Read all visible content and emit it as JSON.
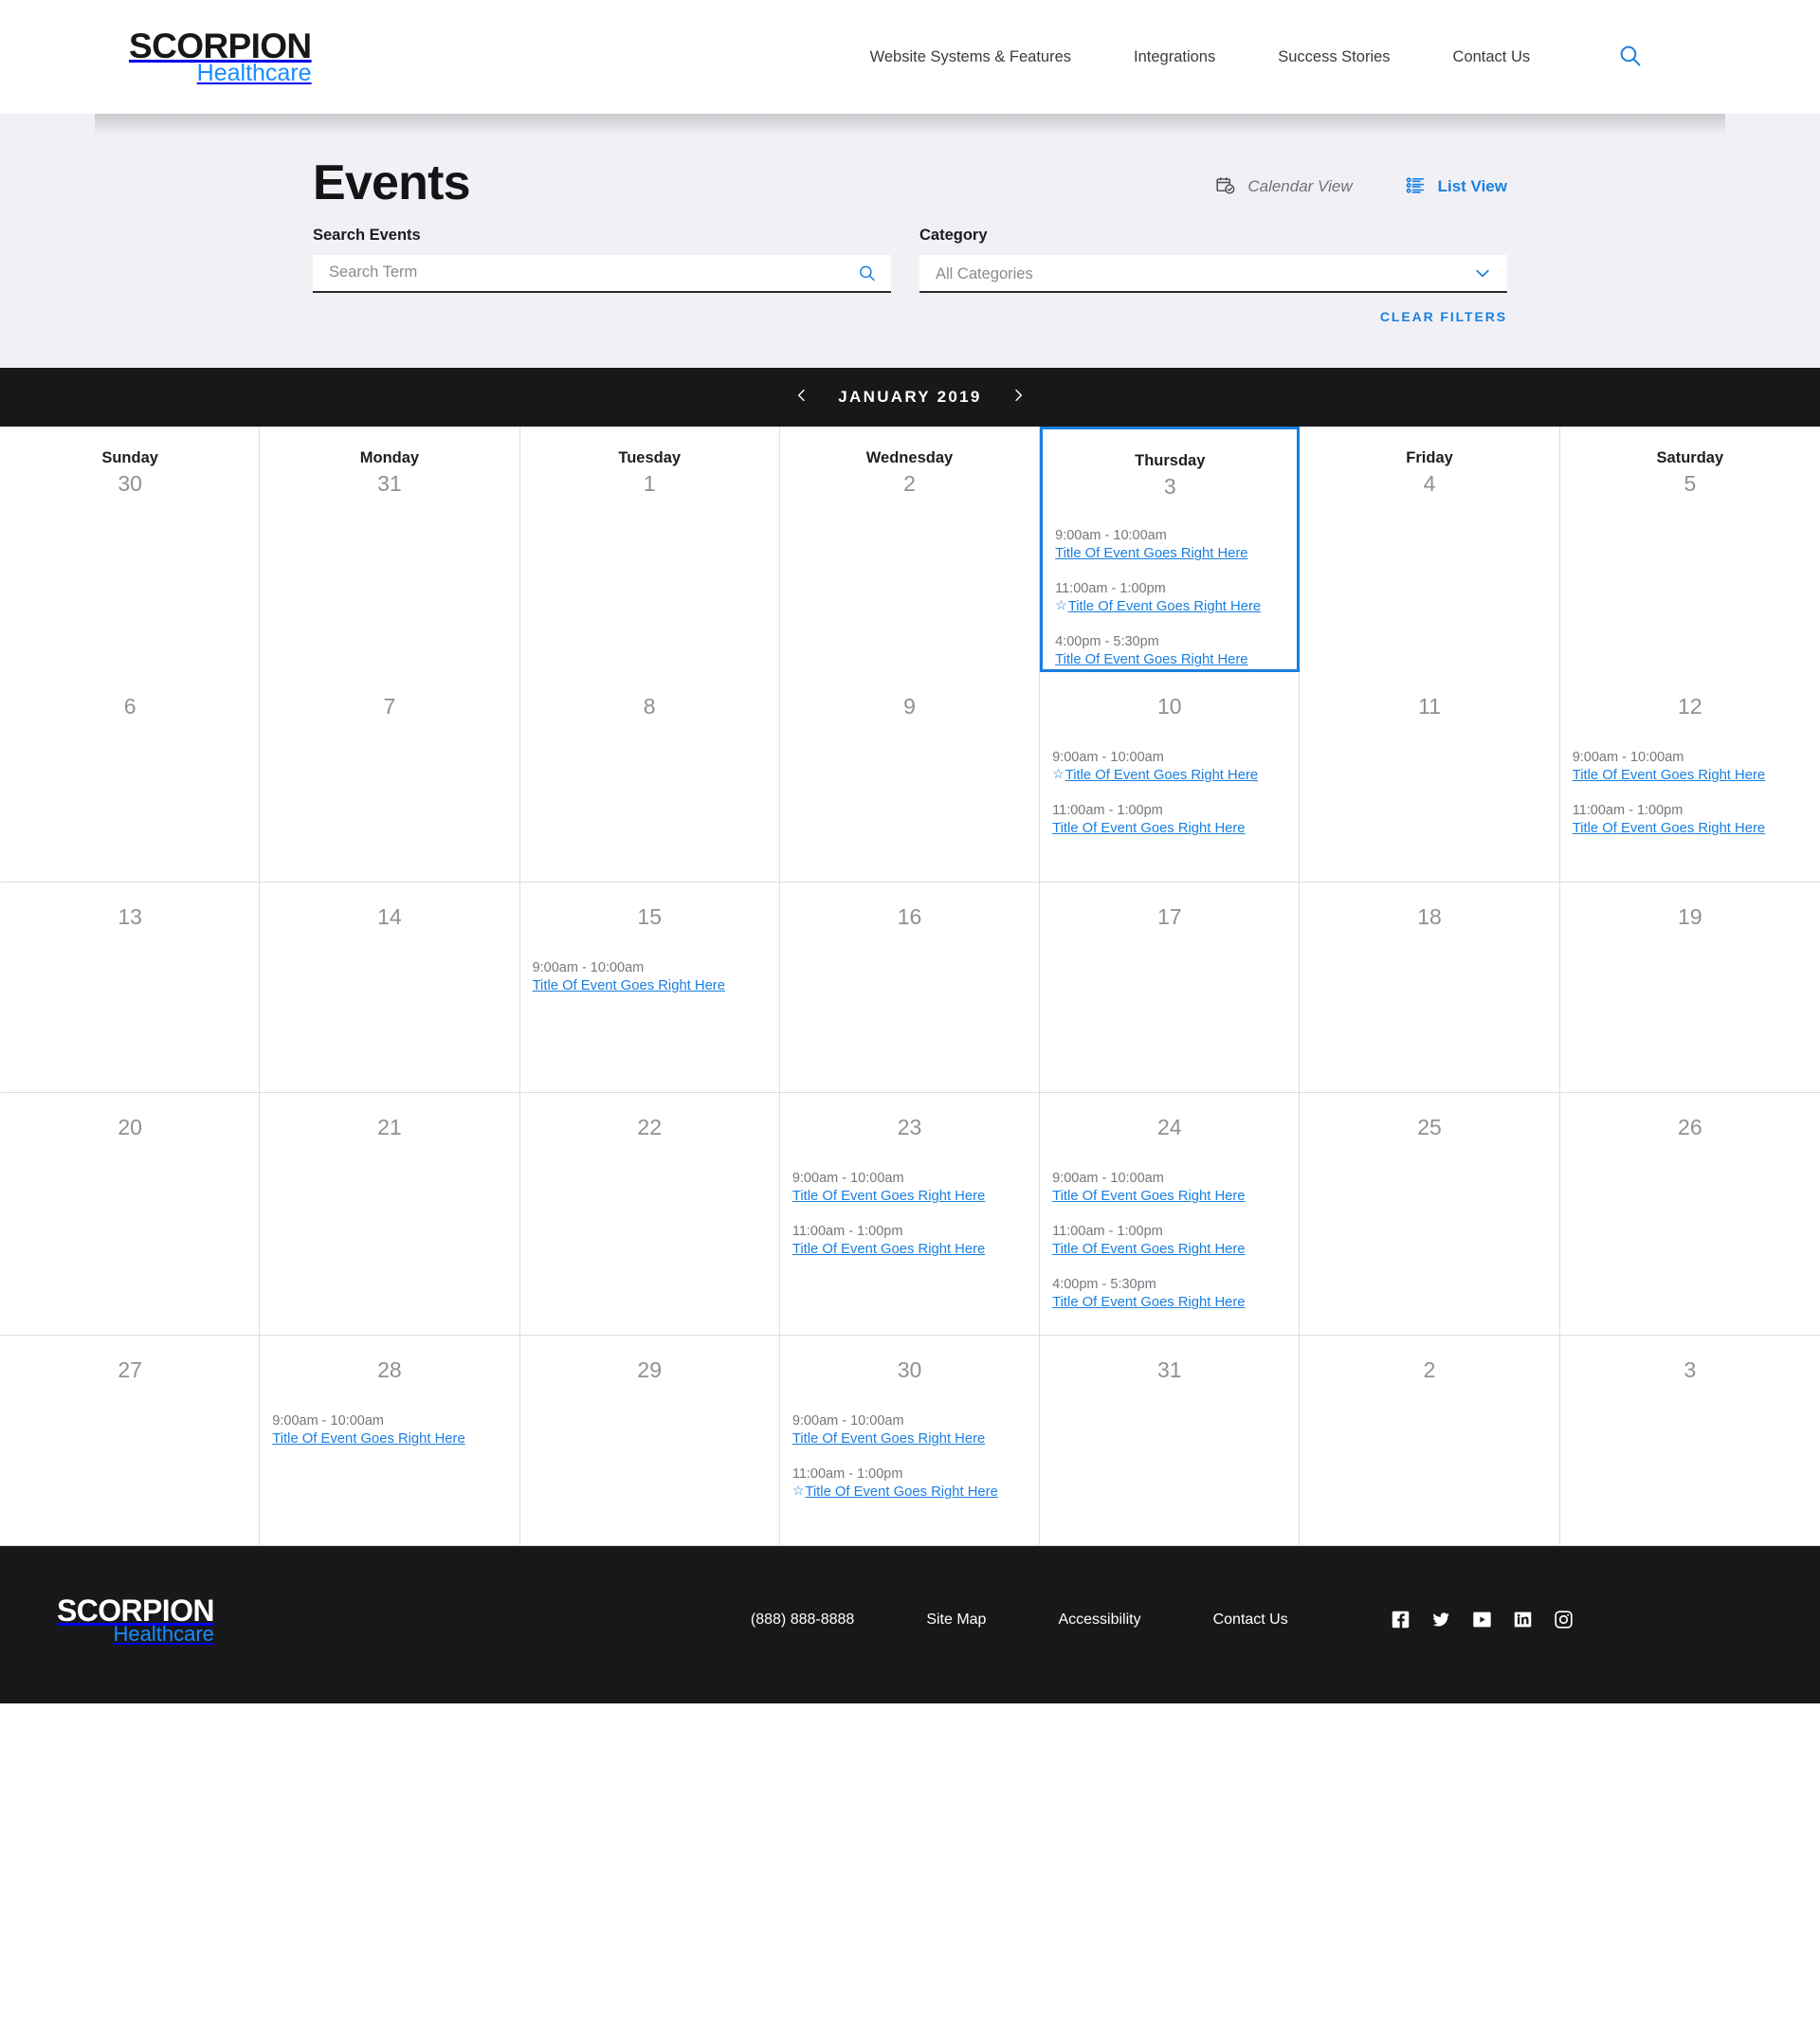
{
  "brand": {
    "name": "SCORPION",
    "vertical": "Healthcare"
  },
  "header": {
    "nav": [
      {
        "label": "Website Systems & Features"
      },
      {
        "label": "Integrations"
      },
      {
        "label": "Success Stories"
      },
      {
        "label": "Contact Us"
      }
    ],
    "search_icon": "search-icon"
  },
  "hero": {
    "title": "Events",
    "views": [
      {
        "label": "Calendar View",
        "icon": "calendar-check-icon",
        "active": false
      },
      {
        "label": "List View",
        "icon": "list-icon",
        "active": true
      }
    ]
  },
  "filters": {
    "search_label": "Search Events",
    "search_placeholder": "Search Term",
    "search_value": "",
    "category_label": "Category",
    "category_value": "All Categories",
    "category_options": [
      "All Categories"
    ],
    "clear_label": "CLEAR FILTERS"
  },
  "calendar": {
    "month_label": "JANUARY 2019",
    "prev_icon": "chevron-left-icon",
    "next_icon": "chevron-right-icon",
    "daynames": [
      "Sunday",
      "Monday",
      "Tuesday",
      "Wednesday",
      "Thursday",
      "Friday",
      "Saturday"
    ],
    "weeks": [
      [
        {
          "daynum": "30",
          "selected": false,
          "events": []
        },
        {
          "daynum": "31",
          "selected": false,
          "events": []
        },
        {
          "daynum": "1",
          "selected": false,
          "events": []
        },
        {
          "daynum": "2",
          "selected": false,
          "events": []
        },
        {
          "daynum": "3",
          "selected": true,
          "events": [
            {
              "time": "9:00am - 10:00am",
              "title": "Title Of Event Goes Right Here",
              "featured": false
            },
            {
              "time": "11:00am - 1:00pm",
              "title": "Title Of Event Goes Right Here",
              "featured": true
            },
            {
              "time": "4:00pm - 5:30pm",
              "title": "Title Of Event Goes Right Here",
              "featured": false
            }
          ]
        },
        {
          "daynum": "4",
          "selected": false,
          "events": []
        },
        {
          "daynum": "5",
          "selected": false,
          "events": []
        }
      ],
      [
        {
          "daynum": "6",
          "selected": false,
          "events": []
        },
        {
          "daynum": "7",
          "selected": false,
          "events": []
        },
        {
          "daynum": "8",
          "selected": false,
          "events": []
        },
        {
          "daynum": "9",
          "selected": false,
          "events": []
        },
        {
          "daynum": "10",
          "selected": false,
          "events": [
            {
              "time": "9:00am - 10:00am",
              "title": "Title Of Event Goes Right Here",
              "featured": true
            },
            {
              "time": "11:00am - 1:00pm",
              "title": "Title Of Event Goes Right Here",
              "featured": false
            }
          ]
        },
        {
          "daynum": "11",
          "selected": false,
          "events": []
        },
        {
          "daynum": "12",
          "selected": false,
          "events": [
            {
              "time": "9:00am - 10:00am",
              "title": "Title Of Event Goes Right Here",
              "featured": false
            },
            {
              "time": "11:00am - 1:00pm",
              "title": "Title Of Event Goes Right Here",
              "featured": false
            }
          ]
        }
      ],
      [
        {
          "daynum": "13",
          "selected": false,
          "events": []
        },
        {
          "daynum": "14",
          "selected": false,
          "events": []
        },
        {
          "daynum": "15",
          "selected": false,
          "events": [
            {
              "time": "9:00am - 10:00am",
              "title": "Title Of Event Goes Right Here",
              "featured": false
            }
          ]
        },
        {
          "daynum": "16",
          "selected": false,
          "events": []
        },
        {
          "daynum": "17",
          "selected": false,
          "events": []
        },
        {
          "daynum": "18",
          "selected": false,
          "events": []
        },
        {
          "daynum": "19",
          "selected": false,
          "events": []
        }
      ],
      [
        {
          "daynum": "20",
          "selected": false,
          "events": []
        },
        {
          "daynum": "21",
          "selected": false,
          "events": []
        },
        {
          "daynum": "22",
          "selected": false,
          "events": []
        },
        {
          "daynum": "23",
          "selected": false,
          "events": [
            {
              "time": "9:00am - 10:00am",
              "title": "Title Of Event Goes Right Here",
              "featured": false
            },
            {
              "time": "11:00am - 1:00pm",
              "title": "Title Of Event Goes Right Here",
              "featured": false
            }
          ]
        },
        {
          "daynum": "24",
          "selected": false,
          "events": [
            {
              "time": "9:00am - 10:00am",
              "title": "Title Of Event Goes Right Here",
              "featured": false
            },
            {
              "time": "11:00am - 1:00pm",
              "title": "Title Of Event Goes Right Here",
              "featured": false
            },
            {
              "time": "4:00pm - 5:30pm",
              "title": "Title Of Event Goes Right Here",
              "featured": false
            }
          ]
        },
        {
          "daynum": "25",
          "selected": false,
          "events": []
        },
        {
          "daynum": "26",
          "selected": false,
          "events": []
        }
      ],
      [
        {
          "daynum": "27",
          "selected": false,
          "events": []
        },
        {
          "daynum": "28",
          "selected": false,
          "events": [
            {
              "time": "9:00am - 10:00am",
              "title": "Title Of Event Goes Right Here",
              "featured": false
            }
          ]
        },
        {
          "daynum": "29",
          "selected": false,
          "events": []
        },
        {
          "daynum": "30",
          "selected": false,
          "events": [
            {
              "time": "9:00am - 10:00am",
              "title": "Title Of Event Goes Right Here",
              "featured": false
            },
            {
              "time": "11:00am - 1:00pm",
              "title": "Title Of Event Goes Right Here",
              "featured": true
            }
          ]
        },
        {
          "daynum": "31",
          "selected": false,
          "events": []
        },
        {
          "daynum": "2",
          "selected": false,
          "events": []
        },
        {
          "daynum": "3",
          "selected": false,
          "events": []
        }
      ]
    ]
  },
  "footer": {
    "links": [
      {
        "label": "(888) 888-8888",
        "name": "phone"
      },
      {
        "label": "Site Map",
        "name": "site-map"
      },
      {
        "label": "Accessibility",
        "name": "accessibility"
      },
      {
        "label": "Contact Us",
        "name": "contact-us"
      }
    ],
    "social": [
      {
        "name": "facebook-icon"
      },
      {
        "name": "twitter-icon"
      },
      {
        "name": "youtube-icon"
      },
      {
        "name": "linkedin-icon"
      },
      {
        "name": "instagram-icon"
      }
    ]
  },
  "colors": {
    "accent": "#1a7fe0",
    "brand_blue": "#1a8cff",
    "dark": "#18181a",
    "panel": "#f1f1f5"
  }
}
